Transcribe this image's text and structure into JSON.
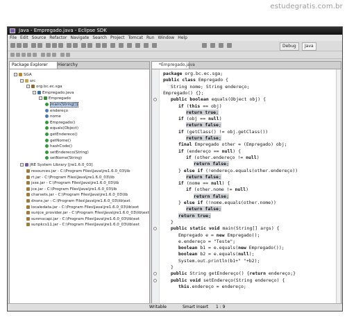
{
  "watermark": "estudegratis.com.br",
  "window": {
    "title": "Java - Empregado.java - Eclipse SDK"
  },
  "menu": [
    "File",
    "Edit",
    "Source",
    "Refactor",
    "Navigate",
    "Search",
    "Project",
    "Tomcat",
    "Run",
    "Window",
    "Help"
  ],
  "perspectives": {
    "debug": "Debug",
    "java": "Java"
  },
  "left_panel": {
    "tabs": [
      "Package Explorer",
      "Hierarchy"
    ],
    "tree": [
      {
        "label": "SGA",
        "depth": 0,
        "type": "project",
        "expanded": true
      },
      {
        "label": "src",
        "depth": 1,
        "type": "folder",
        "expanded": true
      },
      {
        "label": "org.bc.ec.sga",
        "depth": 2,
        "type": "package",
        "expanded": true
      },
      {
        "label": "Empregado.java",
        "depth": 3,
        "type": "file",
        "expanded": true
      },
      {
        "label": "Empregado",
        "depth": 4,
        "type": "class",
        "expanded": true
      },
      {
        "label": "main(String[])",
        "depth": 5,
        "type": "method",
        "selected": true
      },
      {
        "label": "endereço",
        "depth": 5,
        "type": "field"
      },
      {
        "label": "nome",
        "depth": 5,
        "type": "field"
      },
      {
        "label": "Empregado()",
        "depth": 5,
        "type": "method"
      },
      {
        "label": "equals(Object)",
        "depth": 5,
        "type": "method"
      },
      {
        "label": "getEndereco()",
        "depth": 5,
        "type": "method"
      },
      {
        "label": "getNome()",
        "depth": 5,
        "type": "method"
      },
      {
        "label": "hashCode()",
        "depth": 5,
        "type": "method"
      },
      {
        "label": "setEndereco(String)",
        "depth": 5,
        "type": "method"
      },
      {
        "label": "setNome(String)",
        "depth": 5,
        "type": "method"
      },
      {
        "label": "JRE System Library [jre1.6.0_03]",
        "depth": 1,
        "type": "library",
        "expanded": true
      },
      {
        "label": "resources.jar - C:\\Program Files\\Java\\jre1.6.0_03\\lib",
        "depth": 2,
        "type": "jar"
      },
      {
        "label": "rt.jar - C:\\Program Files\\Java\\jre1.6.0_03\\lib",
        "depth": 2,
        "type": "jar"
      },
      {
        "label": "jsse.jar - C:\\Program Files\\Java\\jre1.6.0_03\\lib",
        "depth": 2,
        "type": "jar"
      },
      {
        "label": "jce.jar - C:\\Program Files\\Java\\jre1.6.0_03\\lib",
        "depth": 2,
        "type": "jar"
      },
      {
        "label": "charsets.jar - C:\\Program Files\\Java\\jre1.6.0_03\\lib",
        "depth": 2,
        "type": "jar"
      },
      {
        "label": "dnsns.jar - C:\\Program Files\\Java\\jre1.6.0_03\\lib\\ext",
        "depth": 2,
        "type": "jar"
      },
      {
        "label": "localedata.jar - C:\\Program Files\\Java\\jre1.6.0_03\\lib\\ext",
        "depth": 2,
        "type": "jar"
      },
      {
        "label": "sunjce_provider.jar - C:\\Program Files\\Java\\jre1.6.0_03\\lib\\ext",
        "depth": 2,
        "type": "jar"
      },
      {
        "label": "sunmscapi.jar - C:\\Program Files\\Java\\jre1.6.0_03\\lib\\ext",
        "depth": 2,
        "type": "jar"
      },
      {
        "label": "sunpkcs11.jar - C:\\Program Files\\Java\\jre1.6.0_03\\lib\\ext",
        "depth": 2,
        "type": "jar"
      }
    ]
  },
  "editor": {
    "tab_label": "*Empregado.java",
    "lines": [
      {
        "text": "package org.bc.ec.sga;",
        "indent": 0
      },
      {
        "text": "public class Empregado {",
        "indent": 0
      },
      {
        "text": "String nome; String endereço;",
        "indent": 1
      },
      {
        "text": "Empregado() {};",
        "indent": 0
      },
      {
        "text": "public boolean equals(Object obj) {",
        "indent": 1,
        "fold": true
      },
      {
        "text": "if (this == obj)",
        "indent": 2
      },
      {
        "text": "return true;",
        "indent": 3,
        "hl": true
      },
      {
        "text": "if (obj == null)",
        "indent": 2
      },
      {
        "text": "return false;",
        "indent": 3,
        "hl": true
      },
      {
        "text": "if (getClass() != obj.getClass())",
        "indent": 2
      },
      {
        "text": "return false;",
        "indent": 3,
        "hl": true
      },
      {
        "text": "final Empregado other = (Empregado) obj;",
        "indent": 2
      },
      {
        "text": "if (endereço == null) {",
        "indent": 2
      },
      {
        "text": "if (other.endereço != null)",
        "indent": 3
      },
      {
        "text": "return false;",
        "indent": 4,
        "hl": true
      },
      {
        "text": "} else if (!endereço.equals(other.endereço))",
        "indent": 2
      },
      {
        "text": "return false;",
        "indent": 3,
        "hl": true
      },
      {
        "text": "if (nome == null) {",
        "indent": 2
      },
      {
        "text": "if (other.nome != null)",
        "indent": 3
      },
      {
        "text": "return false;",
        "indent": 4,
        "hl": true
      },
      {
        "text": "} else if (!nome.equals(other.nome))",
        "indent": 2
      },
      {
        "text": "return false;",
        "indent": 3,
        "hl": true
      },
      {
        "text": "return true;",
        "indent": 2,
        "hl": true
      },
      {
        "text": "}",
        "indent": 1
      },
      {
        "text": "public static void main(String[] args) {",
        "indent": 1,
        "fold": true
      },
      {
        "text": "Empregado e = new Empregado();",
        "indent": 2
      },
      {
        "text": "e.endereço = \"Teste\";",
        "indent": 2
      },
      {
        "text": "boolean b1 = e.equals(new Empregado());",
        "indent": 2
      },
      {
        "text": "boolean b2 = e.equals(null);",
        "indent": 2
      },
      {
        "text": "System.out.println(b1+\" \"+b2);",
        "indent": 2
      },
      {
        "text": "}",
        "indent": 1
      },
      {
        "text": "public String getEndereço() {return endereço;}",
        "indent": 1,
        "fold": true
      },
      {
        "text": "public void setEndereço(String endereço) {",
        "indent": 1,
        "fold": true
      },
      {
        "text": "this.endereço = endereço;",
        "indent": 2
      }
    ]
  },
  "status": {
    "writable": "Writable",
    "insert_mode": "Smart Insert",
    "position": "1 : 9"
  }
}
